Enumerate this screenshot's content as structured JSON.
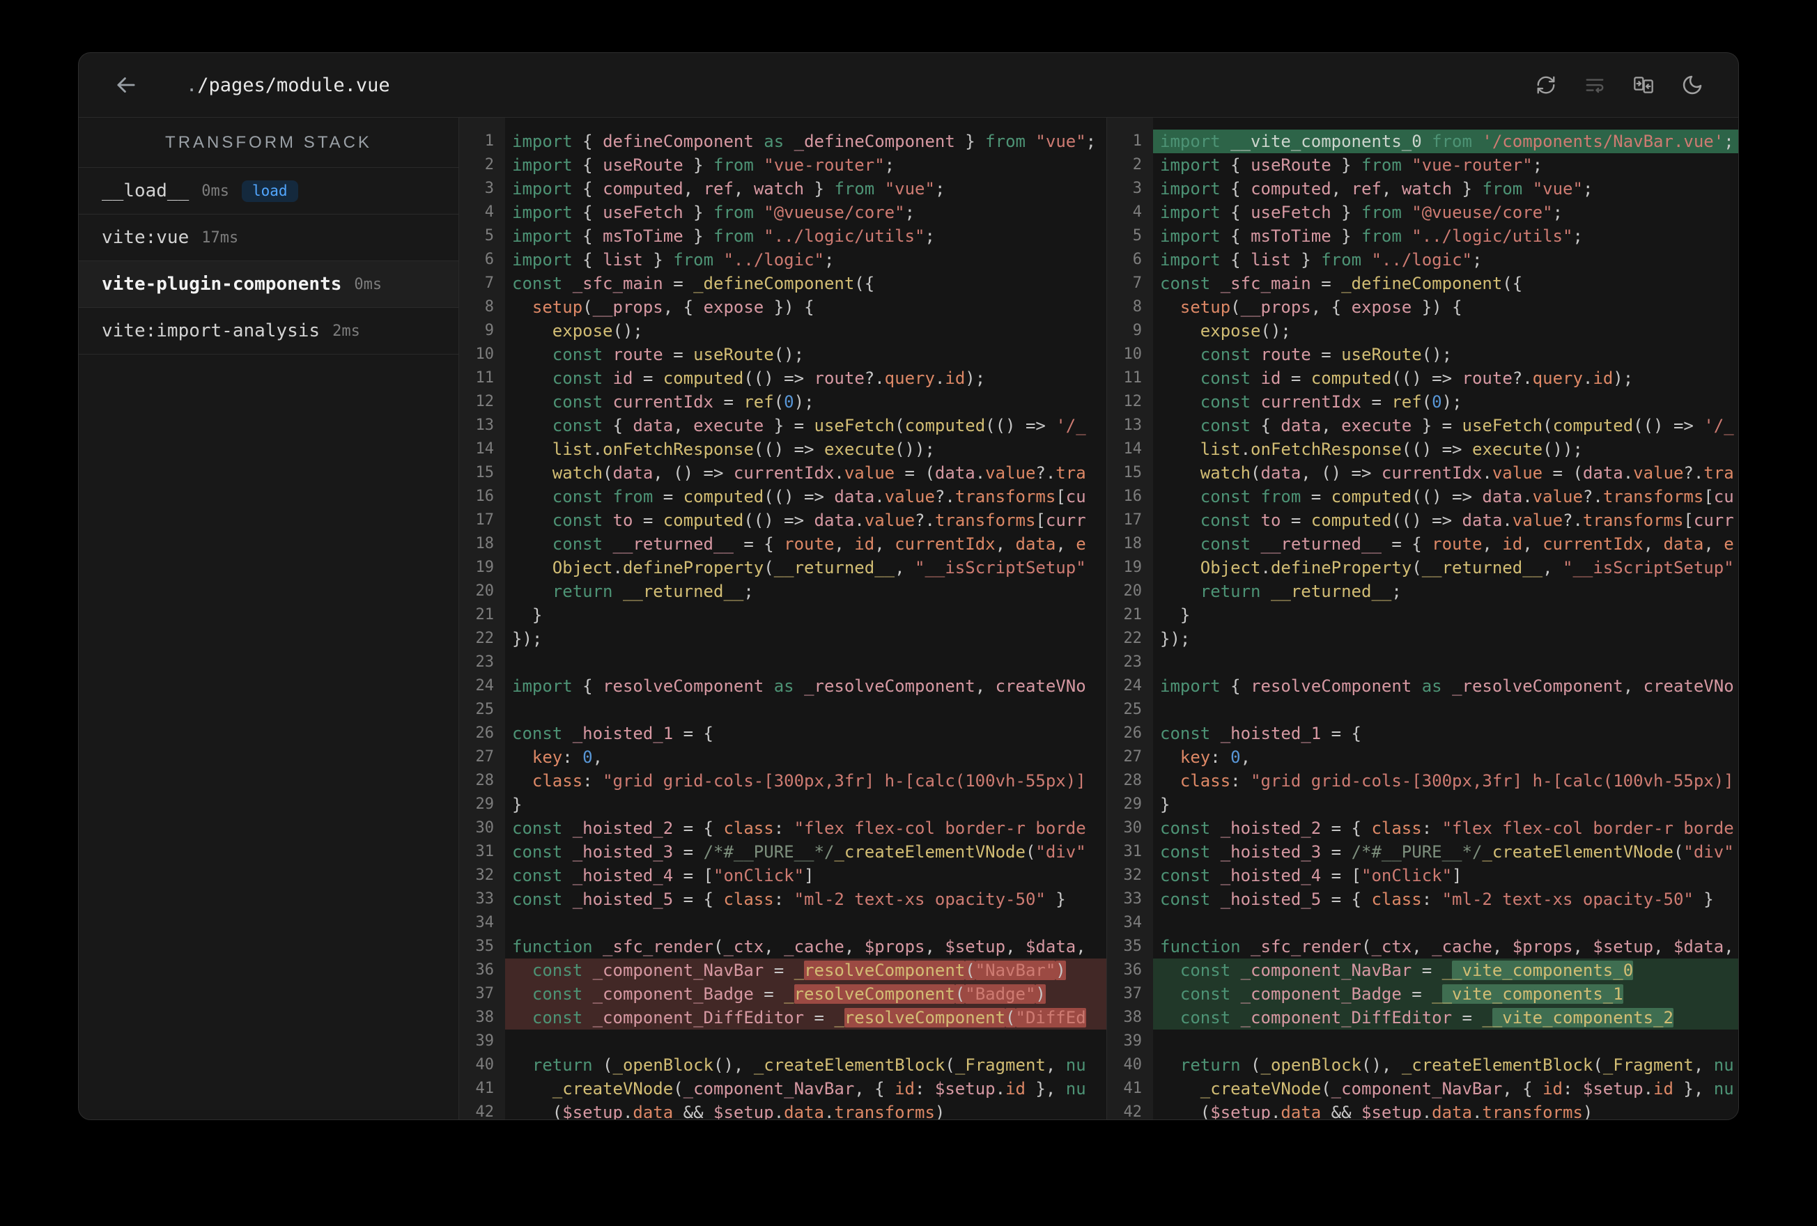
{
  "window": {
    "title_dot": ".",
    "title_path": "/pages/module.vue"
  },
  "topbar": {
    "icons": [
      "refresh-icon",
      "line-wrap-icon",
      "side-by-side-diff-icon",
      "dark-mode-moon-icon"
    ]
  },
  "sidebar": {
    "header": "TRANSFORM STACK",
    "items": [
      {
        "label": "__load__",
        "time": "0ms",
        "badge": "load",
        "selected": false
      },
      {
        "label": "vite:vue",
        "time": "17ms",
        "badge": null,
        "selected": false
      },
      {
        "label": "vite-plugin-components",
        "time": "0ms",
        "badge": null,
        "selected": true
      },
      {
        "label": "vite:import-analysis",
        "time": "2ms",
        "badge": null,
        "selected": false
      }
    ]
  },
  "colors": {
    "window_bg": "#181818",
    "code_bg": "#151515",
    "gutter_bg": "#1e1e1e",
    "divider": "#2a2a2a",
    "badge_fg": "#52a7ff",
    "badge_bg": "#14293d",
    "keyword": "#4d9375",
    "string": "#ce7b72",
    "function": "#d2bd74",
    "identifier": "#d698a2",
    "property": "#dd8866",
    "number": "#5896d6",
    "comment": "#7d8f7d",
    "punctuation": "#c8c8c8",
    "plain_on_added": "#ccd4cc",
    "row_del_bg": "#422826",
    "word_del_bg": "#9c4a43",
    "row_add_bg": "#213829",
    "word_add_bg": "#3f6e51",
    "row_add_full_bg": "#2d6448"
  },
  "code": {
    "lines": [
      "import { defineComponent as _defineComponent } from \"vue\";",
      "import { useRoute } from \"vue-router\";",
      "import { computed, ref, watch } from \"vue\";",
      "import { useFetch } from \"@vueuse/core\";",
      "import { msToTime } from \"../logic/utils\";",
      "import { list } from \"../logic\";",
      "const _sfc_main = _defineComponent({",
      "  setup(__props, { expose }) {",
      "    expose();",
      "    const route = useRoute();",
      "    const id = computed(() => route?.query.id);",
      "    const currentIdx = ref(0);",
      "    const { data, execute } = useFetch(computed(() => '/_",
      "    list.onFetchResponse(() => execute());",
      "    watch(data, () => currentIdx.value = (data.value?.tra",
      "    const from = computed(() => data.value?.transforms[cu",
      "    const to = computed(() => data.value?.transforms[curr",
      "    const __returned__ = { route, id, currentIdx, data, e",
      "    Object.defineProperty(__returned__, \"__isScriptSetup\"",
      "    return __returned__;",
      "  }",
      "});",
      "",
      "import { resolveComponent as _resolveComponent, createVNo",
      "",
      "const _hoisted_1 = {",
      "  key: 0,",
      "  class: \"grid grid-cols-[300px,3fr] h-[calc(100vh-55px)]",
      "}",
      "const _hoisted_2 = { class: \"flex flex-col border-r borde",
      "const _hoisted_3 = /*#__PURE__*/_createElementVNode(\"div\"",
      "const _hoisted_4 = [\"onClick\"]",
      "const _hoisted_5 = { class: \"ml-2 text-xs opacity-50\" }",
      "",
      "function _sfc_render(_ctx, _cache, $props, $setup, $data,",
      "  const _component_NavBar = _resolveComponent(\"NavBar\")",
      "  const _component_Badge = _resolveComponent(\"Badge\")",
      "  const _component_DiffEditor = _resolveComponent(\"DiffEd",
      "",
      "  return (_openBlock(), _createElementBlock(_Fragment, nu",
      "    _createVNode(_component_NavBar, { id: $setup.id }, nu",
      "    ($setup.data && $setup.data.transforms)"
    ],
    "right_overrides": {
      "1": "import __vite_components_0 from '/components/NavBar.vue';",
      "36": "  const _component_NavBar = __vite_components_0",
      "37": "  const _component_Badge = __vite_components_1",
      "38": "  const _component_DiffEditor = __vite_components_2"
    },
    "diff": {
      "removed_rows_left": [
        36,
        37,
        38
      ],
      "added_rows_right": [
        36,
        37,
        38
      ],
      "added_full_rows_right": [
        1
      ],
      "word_start_left": {
        "36": 29,
        "37": 28,
        "38": 33
      },
      "word_start_right": {
        "36": 29,
        "37": 28,
        "38": 33
      }
    },
    "shorthand_prop_lines": [
      18
    ]
  }
}
